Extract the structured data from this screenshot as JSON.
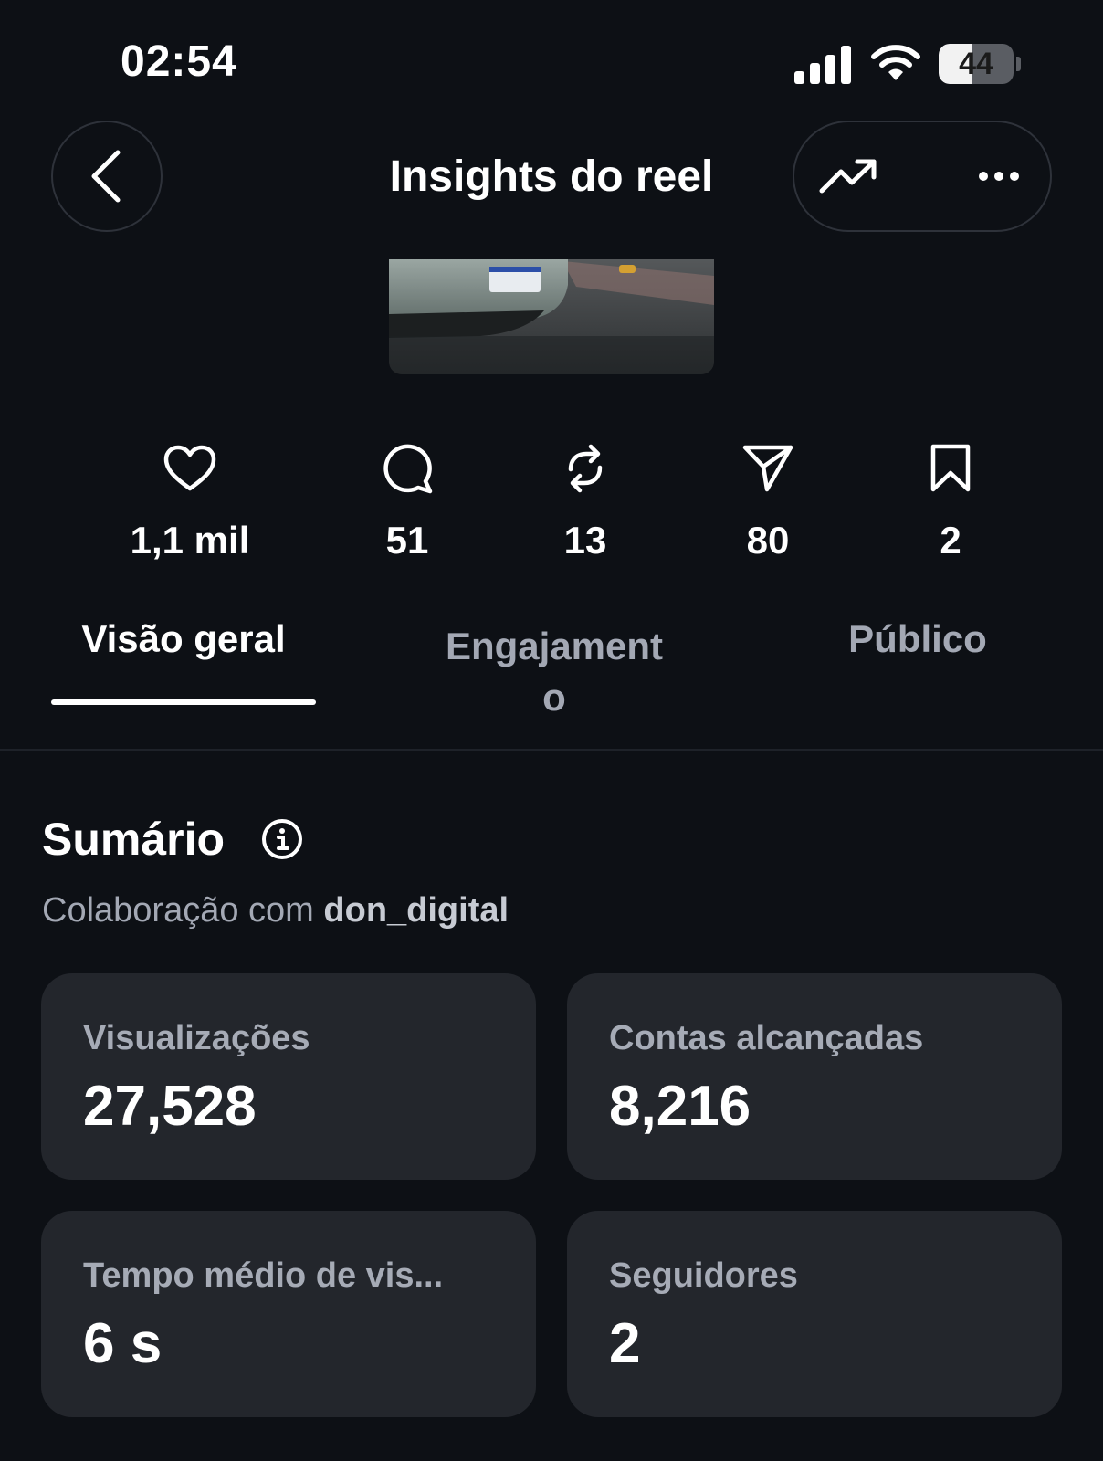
{
  "status_bar": {
    "time": "02:54",
    "battery_level": "44",
    "battery_fraction": 0.44,
    "icons": [
      "signal-icon",
      "wifi-icon",
      "battery-icon"
    ]
  },
  "header": {
    "title": "Insights do reel",
    "icons": [
      "chevron-left-icon",
      "trend-up-icon",
      "more-icon"
    ]
  },
  "stats": [
    {
      "icon": "heart-icon",
      "value": "1,1 mil"
    },
    {
      "icon": "comment-icon",
      "value": "51"
    },
    {
      "icon": "repost-icon",
      "value": "13"
    },
    {
      "icon": "share-icon",
      "value": "80"
    },
    {
      "icon": "bookmark-icon",
      "value": "2"
    }
  ],
  "tabs": [
    {
      "label": "Visão geral",
      "active": true
    },
    {
      "label": "Engajament\no",
      "active": false
    },
    {
      "label": "Público",
      "active": false
    }
  ],
  "summary": {
    "title": "Sumário",
    "collab_prefix": "Colaboração com",
    "collab_user": "don_digital",
    "cards": [
      {
        "label": "Visualizações",
        "value": "27,528"
      },
      {
        "label": "Contas alcançadas",
        "value": "8,216"
      },
      {
        "label": "Tempo médio de vis...",
        "value": "6 s"
      },
      {
        "label": "Seguidores",
        "value": "2"
      }
    ]
  },
  "colors": {
    "background": "#0d1015",
    "card": "#23262c",
    "muted_text": "#a3a8b4"
  }
}
